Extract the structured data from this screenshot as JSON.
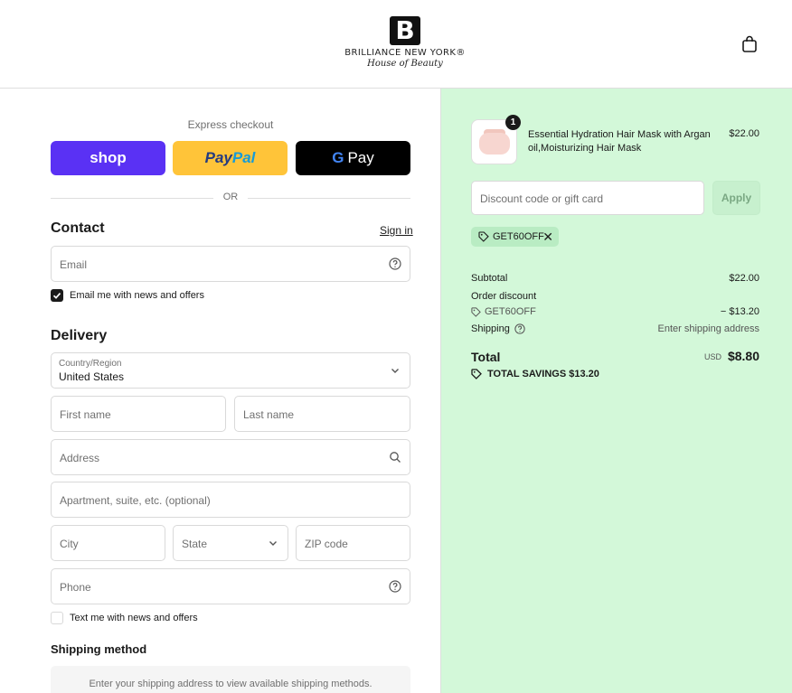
{
  "header": {
    "logo_mark": "B",
    "brand": "BRILLIANCE NEW YORK®",
    "tagline": "House of Beauty",
    "cart_icon": "shopping-bag-icon"
  },
  "express": {
    "label": "Express checkout",
    "shop_label": "shop",
    "paypal_label_1": "Pay",
    "paypal_label_2": "Pal",
    "gpay_g": "G",
    "gpay_label": "Pay",
    "or": "OR"
  },
  "contact": {
    "title": "Contact",
    "signin": "Sign in",
    "email_placeholder": "Email",
    "newsletter_label": "Email me with news and offers",
    "newsletter_checked": true
  },
  "delivery": {
    "title": "Delivery",
    "country_label": "Country/Region",
    "country_value": "United States",
    "first_name": "First name",
    "last_name": "Last name",
    "address": "Address",
    "apartment": "Apartment, suite, etc. (optional)",
    "city": "City",
    "state": "State",
    "zip": "ZIP code",
    "phone": "Phone",
    "sms_label": "Text me with news and offers",
    "sms_checked": false
  },
  "shipping": {
    "title": "Shipping method",
    "message": "Enter your shipping address to view available shipping methods."
  },
  "order": {
    "product": {
      "quantity": "1",
      "name": "Essential Hydration Hair Mask with Argan oil,Moisturizing Hair Mask",
      "price": "$22.00"
    },
    "discount_placeholder": "Discount code or gift card",
    "apply_label": "Apply",
    "applied_code": "GET60OFF",
    "subtotal_label": "Subtotal",
    "subtotal_value": "$22.00",
    "order_discount_label": "Order discount",
    "discount_code": "GET60OFF",
    "discount_value": "− $13.20",
    "shipping_label": "Shipping",
    "shipping_value": "Enter shipping address",
    "total_label": "Total",
    "total_currency": "USD",
    "total_value": "$8.80",
    "savings_label": "TOTAL SAVINGS",
    "savings_value": "$13.20"
  },
  "colors": {
    "shop": "#5a31f4",
    "paypal": "#ffc439",
    "gpay": "#000000",
    "summary_bg": "#d3f8d9",
    "code_tag_bg": "#b9ecc3"
  }
}
